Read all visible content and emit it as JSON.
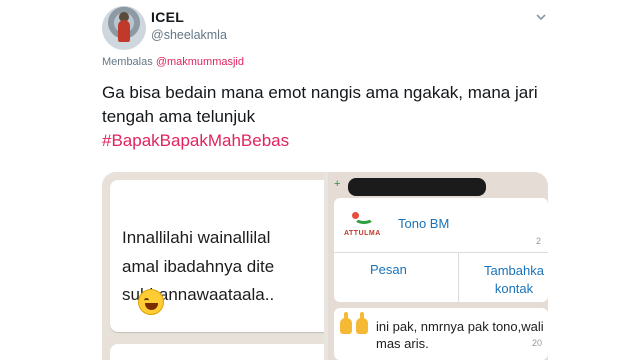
{
  "tweet": {
    "author_name": "ICEL",
    "author_handle": "@sheelakmla",
    "reply_prefix": "Membalas",
    "reply_mention": "@makmummasjid",
    "text": "Ga bisa bedain mana emot nangis ama ngakak, mana jari tengah ama telunjuk",
    "hashtag": "#BapakBapakMahBebas"
  },
  "media": {
    "left_chat": {
      "lines": [
        "Innallilahi wainallilal",
        "amal ibadahnya dite",
        "subhannawaataala.."
      ]
    },
    "right_chat": {
      "plus_sign": "+",
      "contact_name": "Tono BM",
      "logo_text": "ATTULMA",
      "card_time": "2",
      "button_message": "Pesan",
      "button_add_line1": "Tambahka",
      "button_add_line2": "kontak",
      "message_text": "ini pak, nmrnya pak tono,wali mas aris.",
      "message_time": "20"
    }
  },
  "colors": {
    "hashtag": "#e0245e",
    "mention": "#e0245e",
    "secondary_text": "#657786",
    "whatsapp_link": "#1a73b8"
  },
  "icons": [
    "avatar",
    "caret-down-icon",
    "laughing-emoji-icon",
    "thumbs-up-icon"
  ]
}
